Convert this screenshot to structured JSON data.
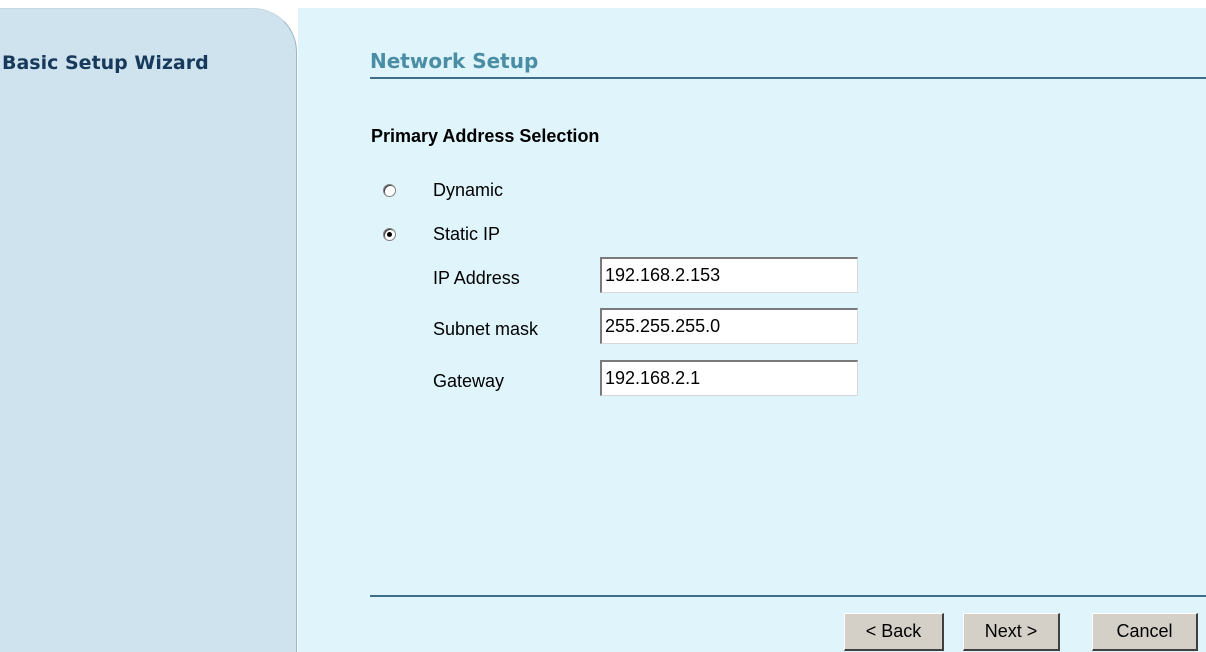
{
  "sidebar": {
    "title": "Basic Setup Wizard"
  },
  "main": {
    "title": "Network Setup",
    "section_heading": "Primary Address Selection",
    "radio_options": [
      {
        "label": "Dynamic",
        "selected": false
      },
      {
        "label": "Static IP",
        "selected": true
      }
    ],
    "fields": {
      "ip_address": {
        "label": "IP Address",
        "value": "192.168.2.153"
      },
      "subnet_mask": {
        "label": "Subnet mask",
        "value": "255.255.255.0"
      },
      "gateway": {
        "label": "Gateway",
        "value": "192.168.2.1"
      }
    }
  },
  "buttons": {
    "back": "< Back",
    "next": "Next >",
    "cancel": "Cancel"
  },
  "colors": {
    "sidebar_bg": "#cfe3ee",
    "content_bg": "#dff4fb",
    "sidebar_title": "#173a5c",
    "page_title": "#4a8ea5",
    "rule": "#3f6f88"
  }
}
